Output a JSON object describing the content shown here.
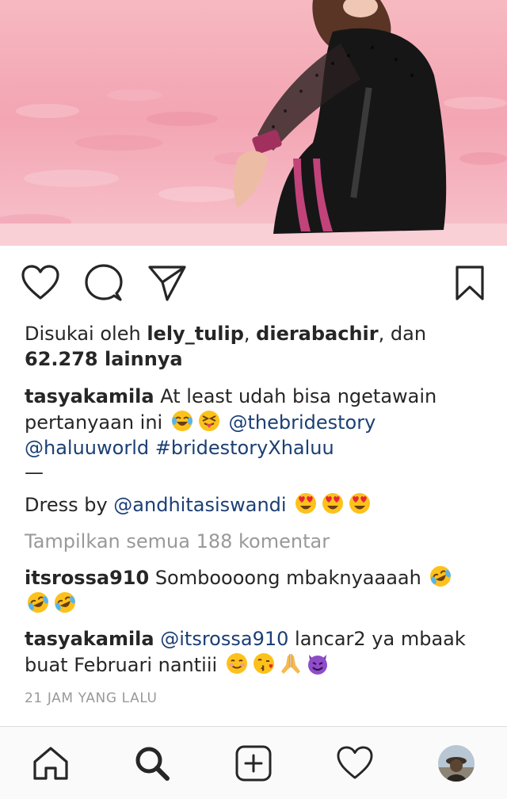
{
  "post": {
    "likes": {
      "prefix": "Disukai oleh ",
      "user1": "lely_tulip",
      "sep": ", ",
      "user2": "dierabachir",
      "and": ", dan",
      "count": "62.278 lainnya"
    },
    "caption": {
      "username": "tasyakamila",
      "text": "At least udah bisa ngetawain pertanyaan ini",
      "emojis": [
        "face-with-tears-of-joy",
        "squinting-face-with-tongue"
      ],
      "mention1": "@thebridestory",
      "mention2": "@haluuworld",
      "hashtag": "#bridestoryXhaluu",
      "dash": "—",
      "dress_prefix": "Dress by ",
      "dress_mention": "@andhitasiswandi",
      "dress_emojis": [
        "heart-eyes",
        "heart-eyes",
        "heart-eyes"
      ]
    },
    "view_all_comments": "Tampilkan semua 188 komentar",
    "comments": [
      {
        "username": "itsrossa910",
        "text": "Somboooong mbaknyaaaah",
        "emojis": [
          "rolling-on-floor-laughing",
          "rolling-on-floor-laughing",
          "rolling-on-floor-laughing"
        ]
      },
      {
        "username": "tasyakamila",
        "mention": "@itsrossa910",
        "text": "lancar2 ya mbaak buat Februari nantiii",
        "emojis": [
          "smiling-face",
          "face-blowing-kiss",
          "folded-hands",
          "smiling-face-with-horns"
        ]
      }
    ],
    "timestamp": "21 JAM YANG LALU"
  },
  "icons": {
    "actions": [
      "heart-icon",
      "comment-icon",
      "share-icon",
      "bookmark-icon"
    ],
    "nav": [
      "home-icon",
      "search-icon",
      "add-icon",
      "activity-heart-icon",
      "profile-avatar"
    ]
  },
  "colors": {
    "text": "#262626",
    "link": "#1b3f74",
    "muted": "#999999"
  }
}
